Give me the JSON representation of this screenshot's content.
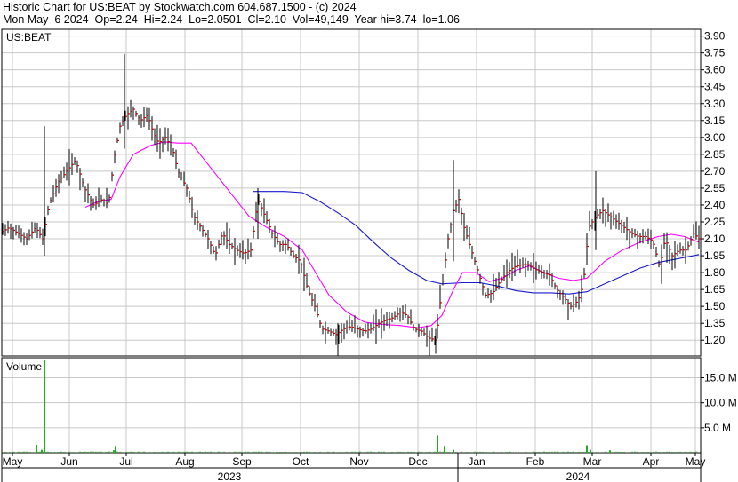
{
  "header": {
    "line1": "Historic Chart for US:BEAT by Stockwatch.com 604.687.1500 - (c) 2024",
    "line2": "Mon May  6 2024  Op=2.24  Hi=2.24  Lo=2.0501  Cl=2.10  Vol=49,149  Year hi=3.74  lo=1.06"
  },
  "colors": {
    "price_bar": "#000000",
    "close_tick": "#cc0000",
    "ma_short": "#ff00ff",
    "ma_long": "#1a1acc",
    "volume": "#22aa22",
    "grid": "#c8c8c8"
  },
  "chart_data": [
    {
      "type": "ohlc",
      "symbol_label": "US:BEAT",
      "y_ticks": [
        "3.90",
        "3.75",
        "3.60",
        "3.45",
        "3.30",
        "3.15",
        "3.00",
        "2.85",
        "2.70",
        "2.55",
        "2.40",
        "2.25",
        "2.10",
        "1.95",
        "1.80",
        "1.65",
        "1.50",
        "1.35",
        "1.20"
      ],
      "ylim": [
        1.06,
        3.96
      ],
      "grid": true,
      "monthly_closes": {
        "months": [
          "May 2023",
          "Jun 2023",
          "Jul 2023",
          "Aug 2023",
          "Sep 2023",
          "Oct 2023",
          "Nov 2023",
          "Dec 2023",
          "Jan 2024",
          "Feb 2024",
          "Mar 2024",
          "Apr 2024",
          "May 2024"
        ],
        "values": [
          2.15,
          2.7,
          3.2,
          2.25,
          2.4,
          1.55,
          1.32,
          1.2,
          1.7,
          1.85,
          2.25,
          2.05,
          2.1
        ]
      },
      "series": [
        {
          "kind": "price",
          "points": [
            [
              0,
              2.15
            ],
            [
              10,
              2.2
            ],
            [
              20,
              2.15
            ],
            [
              30,
              2.1
            ],
            [
              40,
              2.2
            ],
            [
              48,
              2.1
            ],
            [
              55,
              2.4
            ],
            [
              65,
              2.6
            ],
            [
              75,
              2.7
            ],
            [
              85,
              2.8
            ],
            [
              95,
              2.55
            ],
            [
              105,
              2.4
            ],
            [
              115,
              2.45
            ],
            [
              122,
              2.4
            ],
            [
              128,
              2.8
            ],
            [
              135,
              3.1
            ],
            [
              142,
              3.2
            ],
            [
              150,
              3.25
            ],
            [
              158,
              3.15
            ],
            [
              166,
              3.2
            ],
            [
              172,
              3.05
            ],
            [
              178,
              2.95
            ],
            [
              186,
              3.0
            ],
            [
              194,
              2.9
            ],
            [
              200,
              2.7
            ],
            [
              210,
              2.55
            ],
            [
              218,
              2.3
            ],
            [
              226,
              2.2
            ],
            [
              234,
              2.1
            ],
            [
              242,
              1.95
            ],
            [
              250,
              2.15
            ],
            [
              258,
              2.05
            ],
            [
              266,
              2.0
            ],
            [
              274,
              1.97
            ],
            [
              282,
              2.0
            ],
            [
              290,
              2.45
            ],
            [
              298,
              2.3
            ],
            [
              306,
              2.15
            ],
            [
              314,
              2.05
            ],
            [
              322,
              2.05
            ],
            [
              330,
              1.95
            ],
            [
              338,
              1.9
            ],
            [
              346,
              1.65
            ],
            [
              354,
              1.5
            ],
            [
              362,
              1.3
            ],
            [
              370,
              1.28
            ],
            [
              378,
              1.25
            ],
            [
              386,
              1.3
            ],
            [
              394,
              1.32
            ],
            [
              402,
              1.3
            ],
            [
              410,
              1.28
            ],
            [
              418,
              1.3
            ],
            [
              426,
              1.35
            ],
            [
              434,
              1.38
            ],
            [
              442,
              1.4
            ],
            [
              450,
              1.45
            ],
            [
              458,
              1.42
            ],
            [
              466,
              1.3
            ],
            [
              474,
              1.28
            ],
            [
              482,
              1.22
            ],
            [
              490,
              1.2
            ],
            [
              496,
              1.6
            ],
            [
              504,
              2.1
            ],
            [
              510,
              2.35
            ],
            [
              516,
              2.45
            ],
            [
              522,
              2.2
            ],
            [
              530,
              2.0
            ],
            [
              538,
              1.8
            ],
            [
              546,
              1.6
            ],
            [
              554,
              1.62
            ],
            [
              562,
              1.72
            ],
            [
              570,
              1.8
            ],
            [
              578,
              1.85
            ],
            [
              586,
              1.87
            ],
            [
              594,
              1.87
            ],
            [
              602,
              1.83
            ],
            [
              610,
              1.8
            ],
            [
              618,
              1.78
            ],
            [
              626,
              1.65
            ],
            [
              634,
              1.58
            ],
            [
              642,
              1.5
            ],
            [
              650,
              1.55
            ],
            [
              656,
              1.7
            ],
            [
              662,
              2.2
            ],
            [
              670,
              2.3
            ],
            [
              678,
              2.35
            ],
            [
              686,
              2.3
            ],
            [
              694,
              2.25
            ],
            [
              702,
              2.2
            ],
            [
              710,
              2.15
            ],
            [
              718,
              2.12
            ],
            [
              726,
              2.12
            ],
            [
              734,
              2.08
            ],
            [
              742,
              1.85
            ],
            [
              748,
              2.1
            ],
            [
              756,
              1.95
            ],
            [
              764,
              2.0
            ],
            [
              772,
              2.0
            ],
            [
              780,
              2.15
            ],
            [
              786,
              2.1
            ]
          ]
        },
        {
          "kind": "ma_short",
          "points": [
            [
              96,
              2.38
            ],
            [
              110,
              2.43
            ],
            [
              125,
              2.45
            ],
            [
              135,
              2.65
            ],
            [
              150,
              2.85
            ],
            [
              170,
              2.93
            ],
            [
              185,
              2.96
            ],
            [
              200,
              2.95
            ],
            [
              215,
              2.95
            ],
            [
              230,
              2.8
            ],
            [
              245,
              2.65
            ],
            [
              260,
              2.5
            ],
            [
              280,
              2.3
            ],
            [
              300,
              2.2
            ],
            [
              320,
              2.12
            ],
            [
              340,
              2.0
            ],
            [
              355,
              1.8
            ],
            [
              370,
              1.6
            ],
            [
              390,
              1.45
            ],
            [
              410,
              1.36
            ],
            [
              430,
              1.34
            ],
            [
              450,
              1.33
            ],
            [
              470,
              1.31
            ],
            [
              485,
              1.33
            ],
            [
              497,
              1.42
            ],
            [
              510,
              1.65
            ],
            [
              520,
              1.8
            ],
            [
              535,
              1.8
            ],
            [
              550,
              1.72
            ],
            [
              565,
              1.75
            ],
            [
              580,
              1.82
            ],
            [
              595,
              1.86
            ],
            [
              612,
              1.8
            ],
            [
              628,
              1.75
            ],
            [
              645,
              1.73
            ],
            [
              660,
              1.75
            ],
            [
              680,
              1.9
            ],
            [
              700,
              2.0
            ],
            [
              720,
              2.07
            ],
            [
              740,
              2.12
            ],
            [
              755,
              2.14
            ],
            [
              770,
              2.12
            ],
            [
              786,
              2.07
            ]
          ]
        },
        {
          "kind": "ma_long",
          "points": [
            [
              285,
              2.52
            ],
            [
              300,
              2.52
            ],
            [
              320,
              2.52
            ],
            [
              340,
              2.51
            ],
            [
              360,
              2.43
            ],
            [
              380,
              2.33
            ],
            [
              400,
              2.22
            ],
            [
              420,
              2.07
            ],
            [
              440,
              1.93
            ],
            [
              460,
              1.82
            ],
            [
              480,
              1.73
            ],
            [
              497,
              1.7
            ],
            [
              520,
              1.71
            ],
            [
              540,
              1.71
            ],
            [
              560,
              1.68
            ],
            [
              580,
              1.64
            ],
            [
              600,
              1.62
            ],
            [
              620,
              1.62
            ],
            [
              640,
              1.61
            ],
            [
              660,
              1.63
            ],
            [
              680,
              1.7
            ],
            [
              700,
              1.77
            ],
            [
              720,
              1.84
            ],
            [
              740,
              1.89
            ],
            [
              760,
              1.92
            ],
            [
              786,
              1.96
            ]
          ]
        }
      ]
    },
    {
      "type": "bar",
      "title": "Volume",
      "y_ticks": [
        "15.0 M",
        "10.0 M",
        "5.0 M"
      ],
      "ylim": [
        0,
        19
      ],
      "bars": [
        [
          50,
          18.5
        ],
        [
          41,
          1.6
        ],
        [
          47,
          0.6
        ],
        [
          130,
          1.2
        ],
        [
          128,
          0.5
        ],
        [
          492,
          3.5
        ],
        [
          500,
          1.2
        ],
        [
          510,
          0.6
        ],
        [
          660,
          1.5
        ],
        [
          664,
          0.6
        ],
        [
          686,
          0.5
        ]
      ]
    }
  ],
  "x_axis": {
    "months": [
      "May",
      "Jun",
      "Jul",
      "Aug",
      "Sep",
      "Oct",
      "Nov",
      "Dec",
      "Jan",
      "Feb",
      "Mar",
      "Apr",
      "May"
    ],
    "years": [
      "2023",
      "2024"
    ]
  }
}
